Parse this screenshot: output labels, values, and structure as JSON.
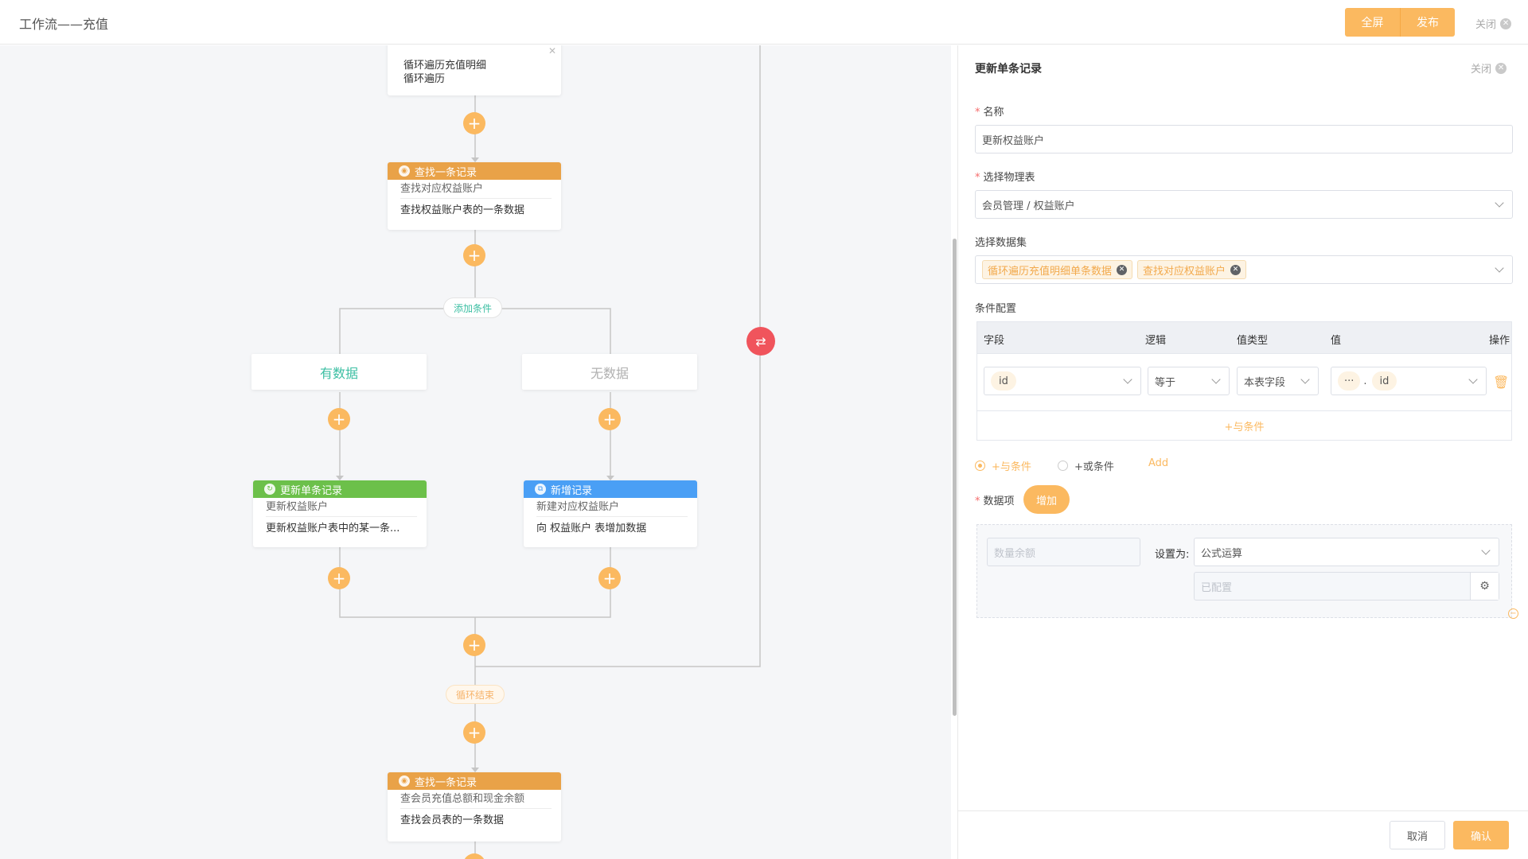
{
  "header": {
    "title": "工作流——充值",
    "fullscreen_label": "全屏",
    "publish_label": "发布",
    "close_label": "关闭"
  },
  "canvas": {
    "loop_node": {
      "title": "循环遍历充值明细",
      "desc": "循环遍历"
    },
    "find_node_1": {
      "head": "查找一条记录",
      "sub": "查找对应权益账户",
      "desc": "查找权益账户表的一条数据"
    },
    "add_condition_label": "添加条件",
    "branch_yes": "有数据",
    "branch_no": "无数据",
    "update_node": {
      "head": "更新单条记录",
      "sub": "更新权益账户",
      "desc": "更新权益账户表中的某一条..."
    },
    "create_node": {
      "head": "新增记录",
      "sub": "新建对应权益账户",
      "desc": "向 权益账户 表增加数据"
    },
    "loop_end_label": "循环结束",
    "find_node_2": {
      "head": "查找一条记录",
      "sub": "查会员充值总额和现金余额",
      "desc": "查找会员表的一条数据"
    }
  },
  "panel": {
    "title": "更新单条记录",
    "close_label": "关闭",
    "name_label": "名称",
    "name_value": "更新权益账户",
    "table_label": "选择物理表",
    "table_value": "会员管理 / 权益账户",
    "dataset_label": "选择数据集",
    "dataset_tags": [
      "循环遍历充值明细单条数据",
      "查找对应权益账户"
    ],
    "condition_label": "条件配置",
    "condition_headers": {
      "field": "字段",
      "logic": "逻辑",
      "value_type": "值类型",
      "value": "值",
      "action": "操作"
    },
    "condition_row": {
      "field": "id",
      "logic": "等于",
      "value_type": "本表字段",
      "value_prefix": "···",
      "value_sep": ".",
      "value_field": "id"
    },
    "and_condition_inline": "+与条件",
    "radio_and": "+与条件",
    "radio_or": "+或条件",
    "add_link": "Add",
    "data_items_label": "数据项",
    "add_button": "增加",
    "data_field_placeholder": "数量余额",
    "set_as_label": "设置为:",
    "set_as_value": "公式运算",
    "configured_placeholder": "已配置",
    "cancel_label": "取消",
    "confirm_label": "确认"
  },
  "colors": {
    "accent": "#fbb960",
    "find_head": "#e9a248",
    "update_head": "#6cc04a",
    "create_head": "#4a9ff5",
    "loop_button": "#f0545c",
    "branch_yes_text": "#3cbfa3",
    "branch_no_text": "#b0b0b0"
  }
}
